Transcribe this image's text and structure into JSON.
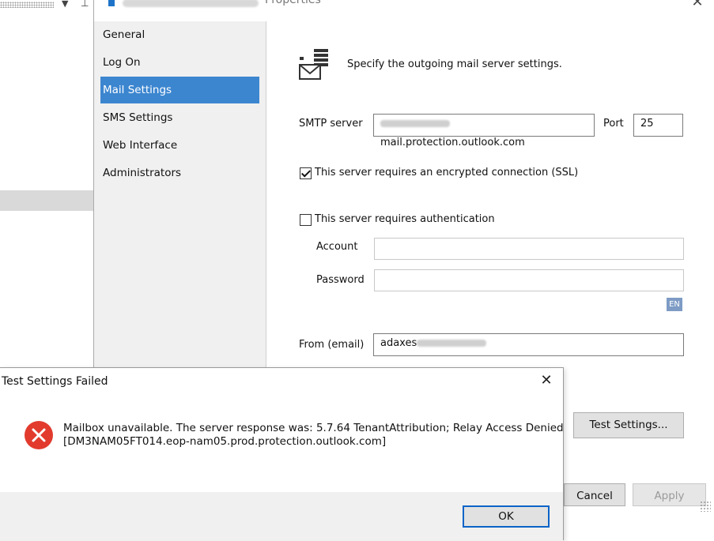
{
  "window": {
    "title_suffix": "Properties",
    "close_glyph": "✕"
  },
  "nav": {
    "items": [
      {
        "label": "General",
        "selected": false
      },
      {
        "label": "Log On",
        "selected": false
      },
      {
        "label": "Mail Settings",
        "selected": true
      },
      {
        "label": "SMS Settings",
        "selected": false
      },
      {
        "label": "Web Interface",
        "selected": false
      },
      {
        "label": "Administrators",
        "selected": false
      }
    ]
  },
  "mail_settings": {
    "heading": "Specify the outgoing mail server settings.",
    "smtp_label": "SMTP server",
    "smtp_value_visible": "mail.protection.outlook.com",
    "port_label": "Port",
    "port_value": "25",
    "ssl_label": "This server requires an encrypted connection (SSL)",
    "ssl_checked": true,
    "auth_label": "This server requires authentication",
    "auth_checked": false,
    "account_label": "Account",
    "account_value": "",
    "password_label": "Password",
    "password_value": "",
    "lang_badge": "EN",
    "from_label": "From (email)",
    "from_value_visible": "adaxes",
    "test_button": "Test Settings...",
    "cancel_button": "Cancel",
    "apply_button": "Apply"
  },
  "error_dialog": {
    "title": "Test Settings Failed",
    "close_glyph": "✕",
    "message_line1": "Mailbox unavailable. The server response was: 5.7.64 TenantAttribution; Relay Access Denied",
    "message_line2": "[DM3NAM05FT014.eop-nam05.prod.protection.outlook.com]",
    "ok_button": "OK"
  },
  "colors": {
    "selection": "#3c86d0",
    "error_red": "#e23b2e",
    "focus_border": "#0a64c8"
  },
  "icons": {
    "mail": "mail-server-icon",
    "error": "error-icon"
  }
}
